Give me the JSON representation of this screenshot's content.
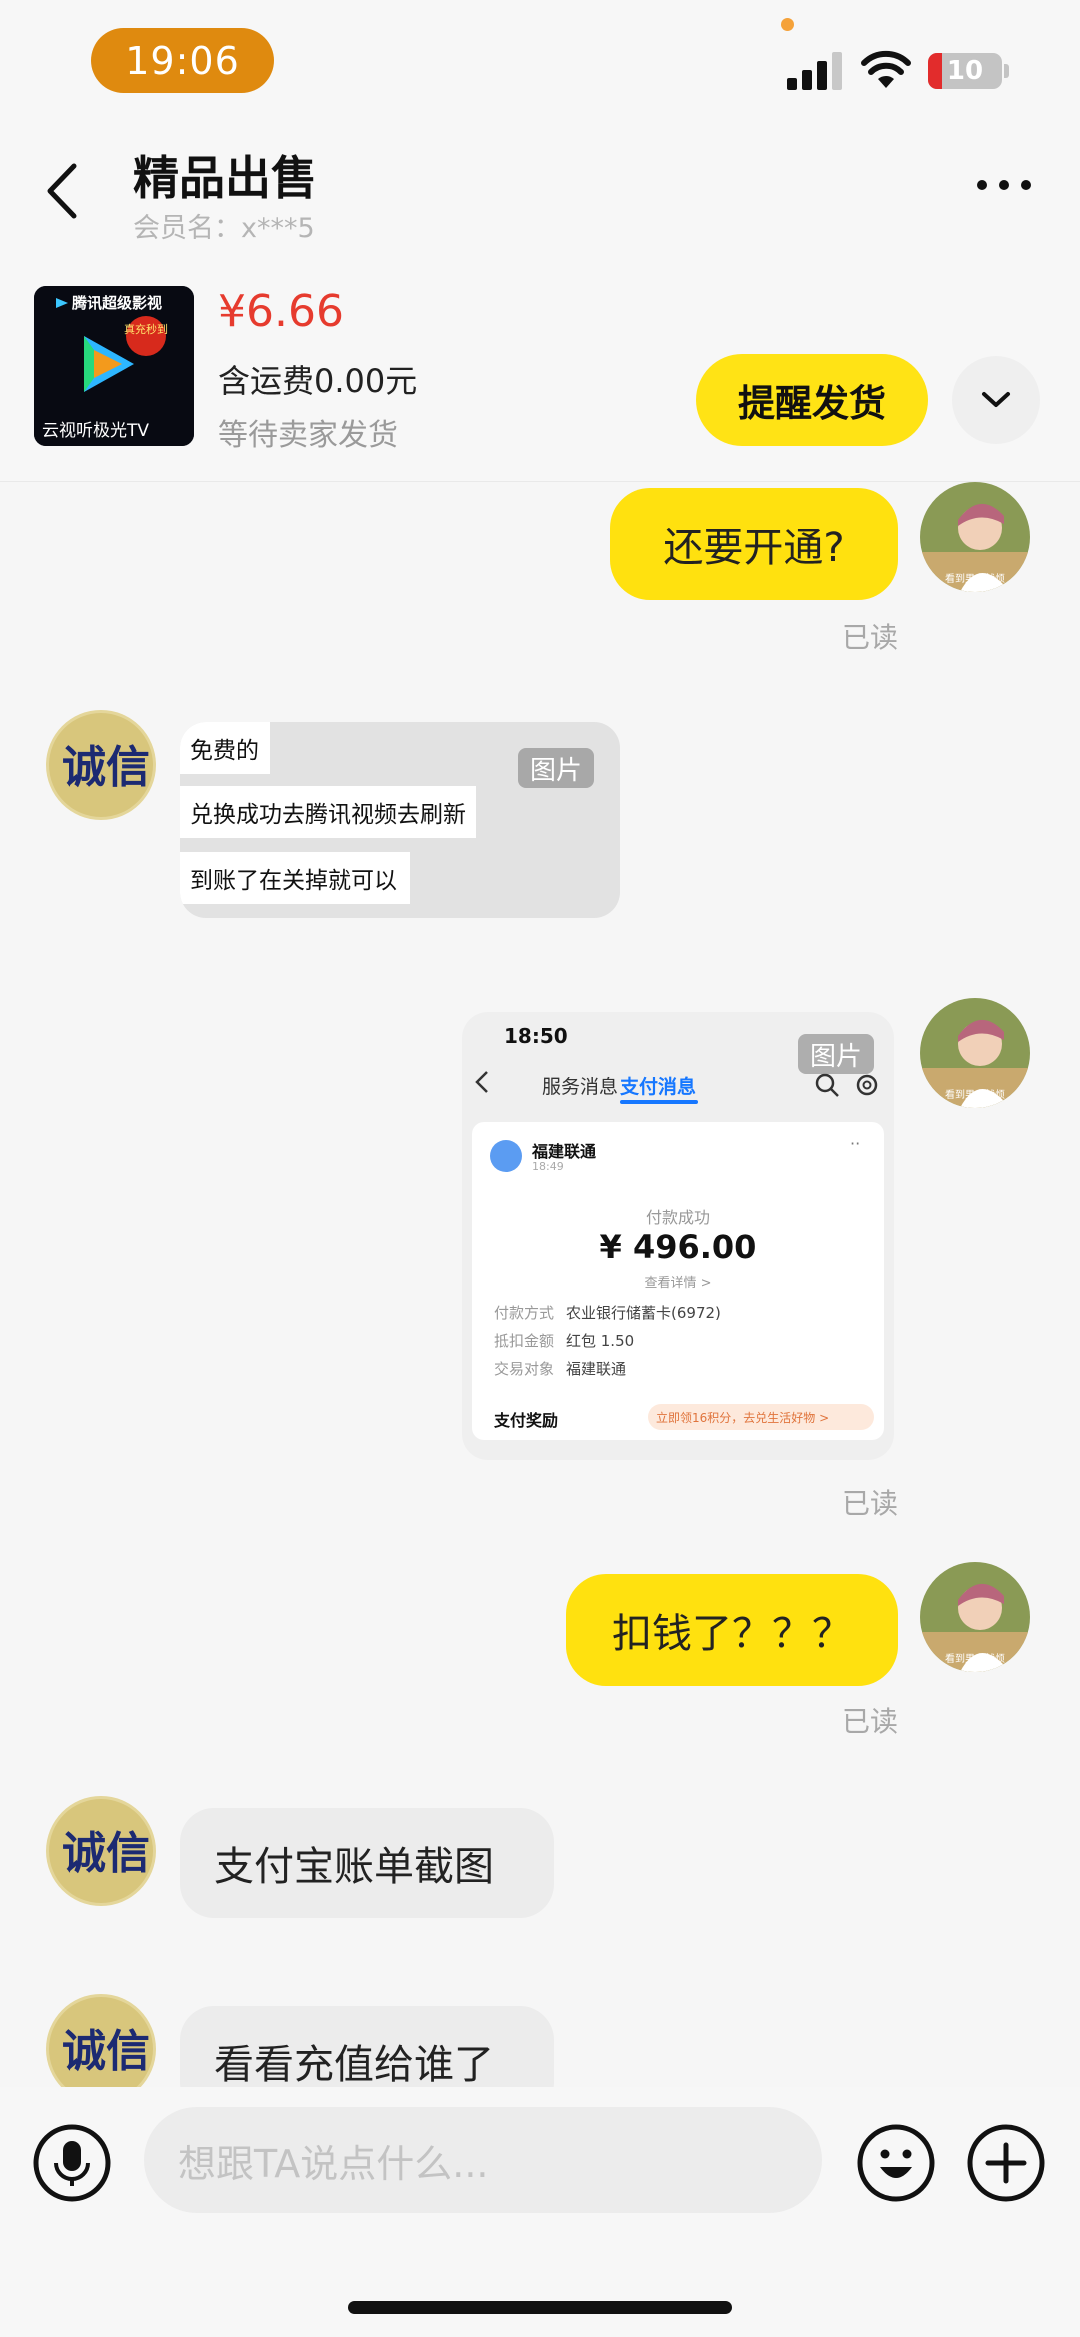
{
  "status_bar": {
    "time": "19:06",
    "battery_level": "10",
    "icons": [
      "signal-icon",
      "wifi-icon",
      "battery-icon"
    ]
  },
  "header": {
    "title": "精品出售",
    "member": "会员名：x***5"
  },
  "product": {
    "thumb_text_top": "腾讯超级影视",
    "thumb_badge": "真充秒到",
    "thumb_text_bottom": "云视听极光TV",
    "price": "¥6.66",
    "shipping": "含运费0.00元",
    "status": "等待卖家发货",
    "remind_label": "提醒发货"
  },
  "chat": {
    "image_label": "图片",
    "read_label": "已读",
    "avatar_self_caption": "看到男人就烦",
    "avatar_seller_text": "诚信",
    "messages": [
      {
        "from": "me",
        "type": "text",
        "text": "还要开通?"
      },
      {
        "from": "seller",
        "type": "image",
        "lines": [
          "免费的",
          "兑换成功去腾讯视频去刷新",
          "到账了在关掉就可以"
        ]
      },
      {
        "from": "me",
        "type": "image"
      },
      {
        "from": "me",
        "type": "text",
        "text": "扣钱了？？？"
      },
      {
        "from": "seller",
        "type": "text",
        "text": "支付宝账单截图"
      },
      {
        "from": "seller",
        "type": "text",
        "text": "看看充值给谁了"
      }
    ],
    "screenshot": {
      "time": "18:50",
      "tab_service": "服务消息",
      "tab_payment": "支付消息",
      "merchant": "福建联通",
      "merchant_time": "18:49",
      "status": "付款成功",
      "amount": "¥ 496.00",
      "detail_link": "查看详情 >",
      "rows": [
        {
          "key": "付款方式",
          "value": "农业银行储蓄卡(6972)"
        },
        {
          "key": "抵扣金额",
          "value": "红包 1.50"
        },
        {
          "key": "交易对象",
          "value": "福建联通"
        }
      ],
      "reward_label": "支付奖励",
      "reward_tag": "立即领16积分，去兑生活好物 >"
    }
  },
  "input": {
    "placeholder": "想跟TA说点什么..."
  },
  "colors": {
    "accent_yellow": "#ffe10f",
    "price_red": "#e63b2e",
    "time_pill": "#df8a0f",
    "alipay_blue": "#1677ff"
  }
}
